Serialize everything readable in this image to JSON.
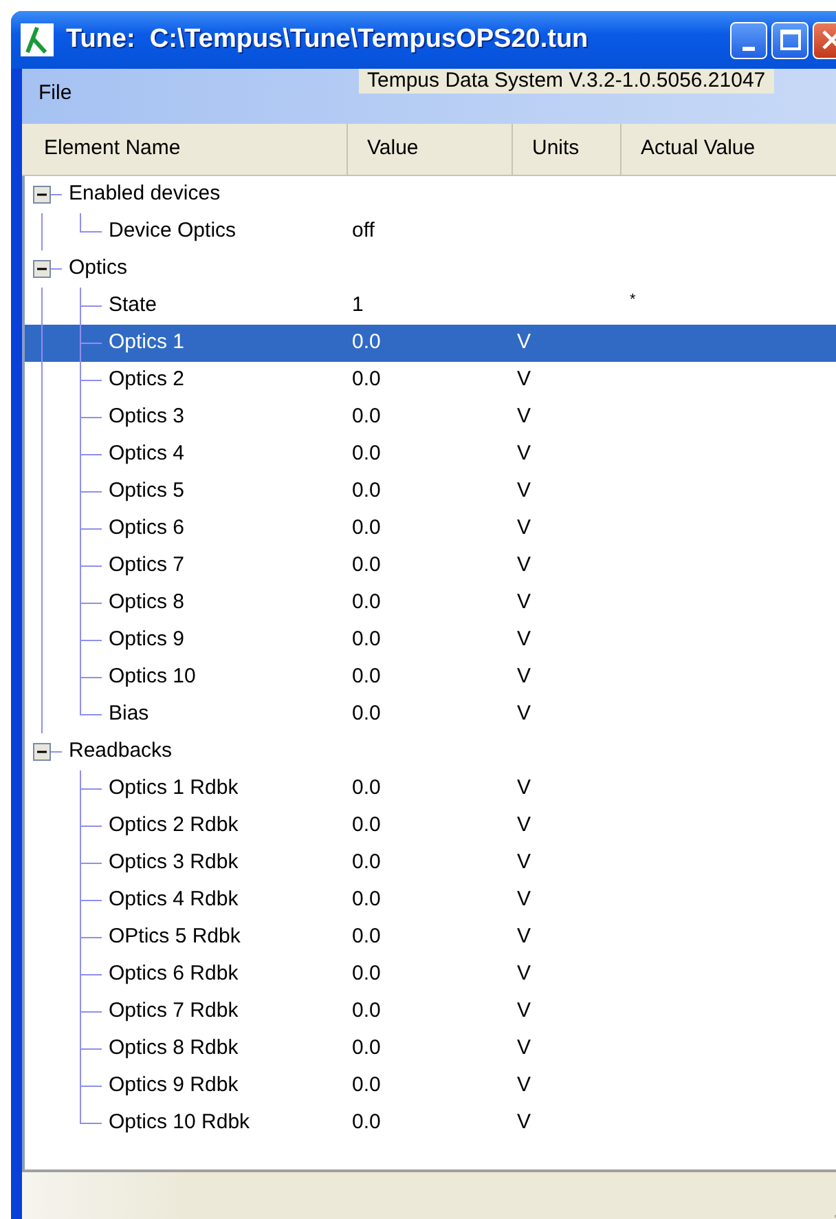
{
  "window": {
    "title": "Tune:  C:\\Tempus\\Tune\\TempusOPS20.tun"
  },
  "menu": [
    "File"
  ],
  "version_label": "Tempus Data System V.3.2-1.0.5056.21047",
  "columns": [
    "Element Name",
    "Value",
    "Units",
    "Actual Value"
  ],
  "tree": [
    {
      "name": "Enabled devices",
      "expanded": true,
      "selected": false,
      "children": [
        {
          "name": "Device Optics",
          "value": "off",
          "selected": false
        }
      ]
    },
    {
      "name": "Optics",
      "expanded": true,
      "selected": false,
      "children": [
        {
          "name": "State",
          "value": "1",
          "actual_value": "*",
          "selected": false
        },
        {
          "name": "Optics 1",
          "value": "0.0",
          "units": "V",
          "selected": true
        },
        {
          "name": "Optics 2",
          "value": "0.0",
          "units": "V",
          "selected": false
        },
        {
          "name": "Optics 3",
          "value": "0.0",
          "units": "V",
          "selected": false
        },
        {
          "name": "Optics 4",
          "value": "0.0",
          "units": "V",
          "selected": false
        },
        {
          "name": "Optics 5",
          "value": "0.0",
          "units": "V",
          "selected": false
        },
        {
          "name": "Optics 6",
          "value": "0.0",
          "units": "V",
          "selected": false
        },
        {
          "name": "Optics 7",
          "value": "0.0",
          "units": "V",
          "selected": false
        },
        {
          "name": "Optics 8",
          "value": "0.0",
          "units": "V",
          "selected": false
        },
        {
          "name": "Optics 9",
          "value": "0.0",
          "units": "V",
          "selected": false
        },
        {
          "name": "Optics 10",
          "value": "0.0",
          "units": "V",
          "selected": false
        },
        {
          "name": "Bias",
          "value": "0.0",
          "units": "V",
          "selected": false
        }
      ]
    },
    {
      "name": "Readbacks",
      "expanded": true,
      "selected": false,
      "children": [
        {
          "name": "Optics 1 Rdbk",
          "value": "0.0",
          "units": "V",
          "selected": false
        },
        {
          "name": "Optics 2 Rdbk",
          "value": "0.0",
          "units": "V",
          "selected": false
        },
        {
          "name": "Optics 3 Rdbk",
          "value": "0.0",
          "units": "V",
          "selected": false
        },
        {
          "name": "Optics 4 Rdbk",
          "value": "0.0",
          "units": "V",
          "selected": false
        },
        {
          "name": "OPtics 5 Rdbk",
          "value": "0.0",
          "units": "V",
          "selected": false
        },
        {
          "name": "Optics 6 Rdbk",
          "value": "0.0",
          "units": "V",
          "selected": false
        },
        {
          "name": "Optics 7 Rdbk",
          "value": "0.0",
          "units": "V",
          "selected": false
        },
        {
          "name": "Optics 8 Rdbk",
          "value": "0.0",
          "units": "V",
          "selected": false
        },
        {
          "name": "Optics 9 Rdbk",
          "value": "0.0",
          "units": "V",
          "selected": false
        },
        {
          "name": "Optics 10 Rdbk",
          "value": "0.0",
          "units": "V",
          "selected": false
        }
      ]
    }
  ]
}
